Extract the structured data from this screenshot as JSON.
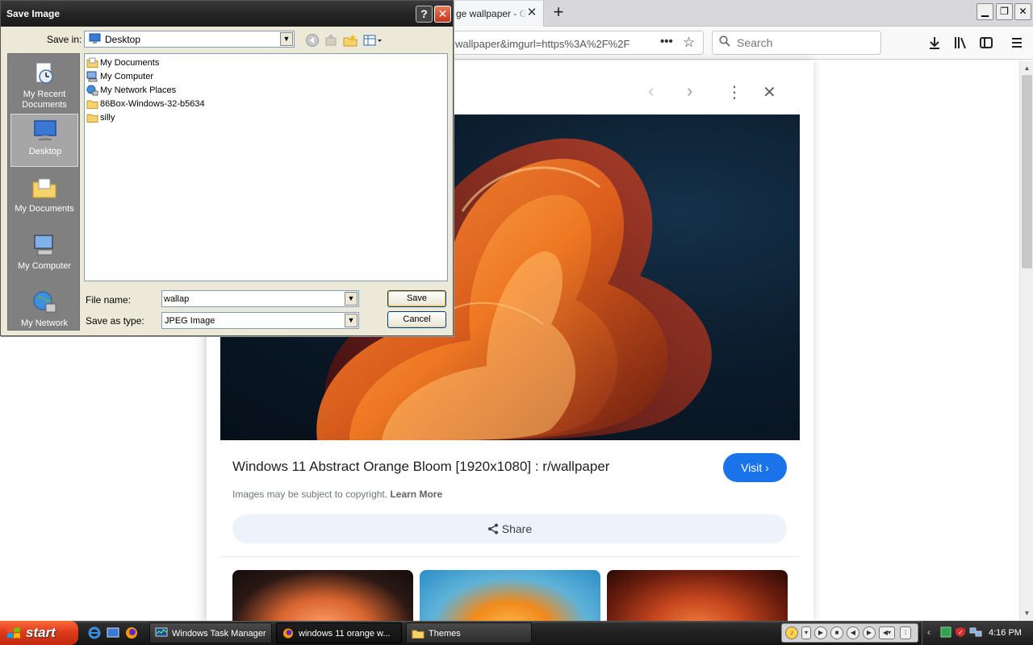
{
  "browser": {
    "tab_title": "ge wallpaper - Go",
    "tab_close": "✕",
    "new_tab": "+",
    "url": "wallpaper&imgurl=https%3A%2F%2F",
    "url_more": "•••",
    "search_placeholder": "Search",
    "window_controls": {
      "minimize": "▁",
      "restore": "❐",
      "close": "✕"
    }
  },
  "image_panel": {
    "nav_prev": "‹",
    "nav_next": "›",
    "more": "⋮",
    "close": "✕",
    "title": "Windows 11 Abstract Orange Bloom [1920x1080] : r/wallpaper",
    "visit_label": "Visit",
    "visit_chevron": "›",
    "copyright_text": "Images may be subject to copyright.",
    "learn_more": "Learn More",
    "share_label": "Share"
  },
  "dialog": {
    "title": "Save Image",
    "help": "?",
    "close": "✕",
    "save_in_label": "Save in:",
    "save_in_value": "Desktop",
    "places": [
      {
        "label": "My Recent Documents"
      },
      {
        "label": "Desktop"
      },
      {
        "label": "My Documents"
      },
      {
        "label": "My Computer"
      },
      {
        "label": "My Network"
      }
    ],
    "files": [
      {
        "label": "My Documents"
      },
      {
        "label": "My Computer"
      },
      {
        "label": "My Network Places"
      },
      {
        "label": "86Box-Windows-32-b5634"
      },
      {
        "label": "silly"
      }
    ],
    "file_name_label": "File name:",
    "file_name_value": "wallap",
    "save_as_type_label": "Save as type:",
    "save_as_type_value": "JPEG Image",
    "save_button": "Save",
    "cancel_button": "Cancel"
  },
  "taskbar": {
    "start_label": "start",
    "tasks": [
      {
        "label": "Windows Task Manager"
      },
      {
        "label": "windows 11 orange w..."
      },
      {
        "label": "Themes"
      }
    ],
    "clock": "4:16 PM"
  },
  "colors": {
    "visit_button": "#1a73e8",
    "share_button_bg": "#eef3fb",
    "start_button": "#dd3b1c",
    "dialog_bg": "#ece9d8"
  }
}
